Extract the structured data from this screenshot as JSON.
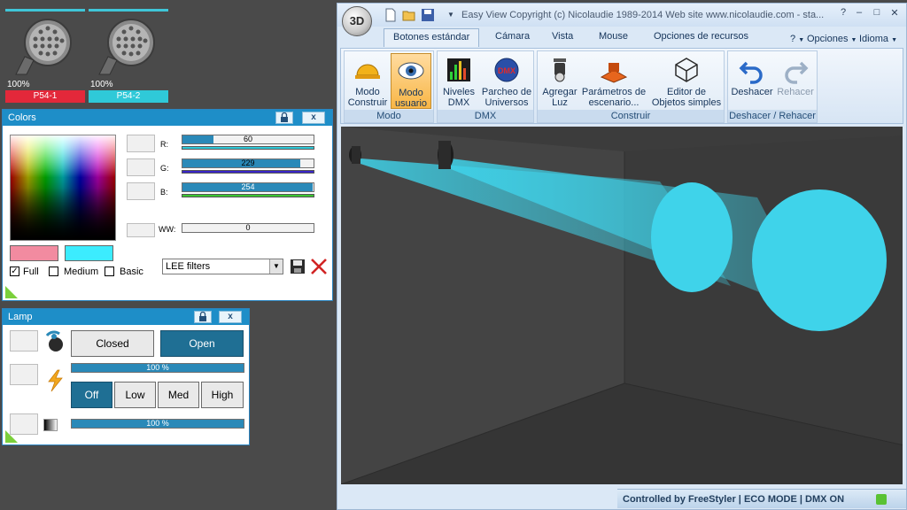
{
  "fixtures": [
    {
      "name": "P54-1",
      "level": "100%",
      "bar_color": "#e3283a"
    },
    {
      "name": "P54-2",
      "level": "100%",
      "bar_color": "#2fc9d8"
    }
  ],
  "colors_panel": {
    "title": "Colors",
    "close_label": "x",
    "channels": [
      {
        "label": "R:",
        "value": "60",
        "fraction": 0.235,
        "underline_color": "#2fc9d8"
      },
      {
        "label": "G:",
        "value": "229",
        "fraction": 0.898,
        "underline_color": "#3a25c8"
      },
      {
        "label": "B:",
        "value": "254",
        "fraction": 0.996,
        "underline_color": "#3cc631"
      }
    ],
    "ww": {
      "label": "WW:",
      "value": "0",
      "fraction": 0
    },
    "current_color": "#f28ba0",
    "target_color": "#3cecfe",
    "modes": [
      {
        "label": "Full",
        "checked": "✓"
      },
      {
        "label": "Medium",
        "checked": ""
      },
      {
        "label": "Basic",
        "checked": ""
      }
    ],
    "filter_select": "LEE filters"
  },
  "lamp_panel": {
    "title": "Lamp",
    "close_label": "x",
    "shutter": {
      "closed_label": "Closed",
      "open_label": "Open",
      "selected": "Open"
    },
    "dimmer": {
      "value": "100 %",
      "fraction": 1.0
    },
    "strobe": {
      "options": [
        "Off",
        "Low",
        "Med",
        "High"
      ],
      "selected": "Off"
    },
    "intensity": {
      "value": "100 %",
      "fraction": 1.0
    }
  },
  "main_window": {
    "orb_label": "3D",
    "title": "Easy View   Copyright (c) Nicolaudie 1989-2014   Web site www.nicolaudie.com - sta...",
    "window_controls": [
      "?",
      "–",
      "□",
      "✕"
    ],
    "tabs": [
      "Botones estándar",
      "Cámara",
      "Vista",
      "Mouse",
      "Opciones de recursos"
    ],
    "active_tab": "Botones estándar",
    "right_menus": [
      "?",
      "Opciones",
      "Idioma"
    ],
    "groups": [
      {
        "label": "Modo",
        "buttons": [
          {
            "label1": "Modo",
            "label2": "Construir",
            "icon": "hardhat-icon"
          },
          {
            "label1": "Modo",
            "label2": "usuario",
            "icon": "eye-icon",
            "selected": true
          }
        ]
      },
      {
        "label": "DMX",
        "buttons": [
          {
            "label1": "Niveles",
            "label2": "DMX",
            "icon": "levels-icon"
          },
          {
            "label1": "Parcheo de",
            "label2": "Universos",
            "icon": "dmx-globe-icon"
          }
        ]
      },
      {
        "label": "Construir",
        "buttons": [
          {
            "label1": "Agregar",
            "label2": "Luz",
            "icon": "light-icon"
          },
          {
            "label1": "Parámetros de",
            "label2": "escenario...",
            "icon": "stage-icon"
          },
          {
            "label1": "Editor de",
            "label2": "Objetos simples",
            "icon": "cube-icon"
          }
        ]
      },
      {
        "label": "Deshacer / Rehacer",
        "buttons": [
          {
            "label1": "Deshacer",
            "label2": "",
            "icon": "undo-icon"
          },
          {
            "label1": "Rehacer",
            "label2": "",
            "icon": "redo-icon",
            "disabled": true
          }
        ]
      }
    ],
    "status": "Controlled by FreeStyler  |  ECO MODE  |  DMX ON",
    "beam_color": "#3fd3ea"
  }
}
